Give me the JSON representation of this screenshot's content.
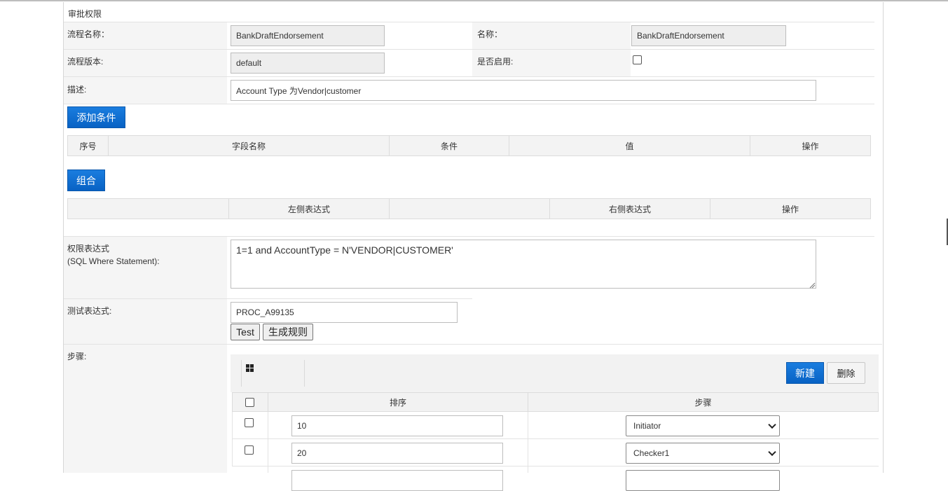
{
  "section_title": "审批权限",
  "fields": {
    "process_name_label": "流程名称：",
    "process_name_value": "BankDraftEndorsement",
    "name_label": "名称：",
    "name_value": "BankDraftEndorsement",
    "process_version_label": "流程版本:",
    "process_version_value": "default",
    "enabled_label": "是否启用:",
    "description_label": "描述:",
    "description_value": "Account Type 为Vendor|customer"
  },
  "conditions": {
    "add_button": "添加条件",
    "columns": [
      "序号",
      "字段名称",
      "条件",
      "值",
      "操作"
    ]
  },
  "group": {
    "button": "组合",
    "columns": [
      "",
      "左侧表达式",
      "",
      "右侧表达式",
      "操作"
    ]
  },
  "permission": {
    "label_line1": "权限表达式",
    "label_line2": "(SQL Where Statement):",
    "value": "1=1 and AccountType = N'VENDOR|CUSTOMER'"
  },
  "test": {
    "label": "测试表达式:",
    "value": "PROC_A99135",
    "test_button": "Test",
    "generate_button": "生成规则"
  },
  "steps": {
    "label": "步骤:",
    "grid_icon": "grid-icon",
    "new_button": "新建",
    "delete_button": "删除",
    "columns": [
      "排序",
      "步骤"
    ],
    "rows": [
      {
        "order": "10",
        "step": "Initiator"
      },
      {
        "order": "20",
        "step": "Checker1"
      }
    ]
  }
}
